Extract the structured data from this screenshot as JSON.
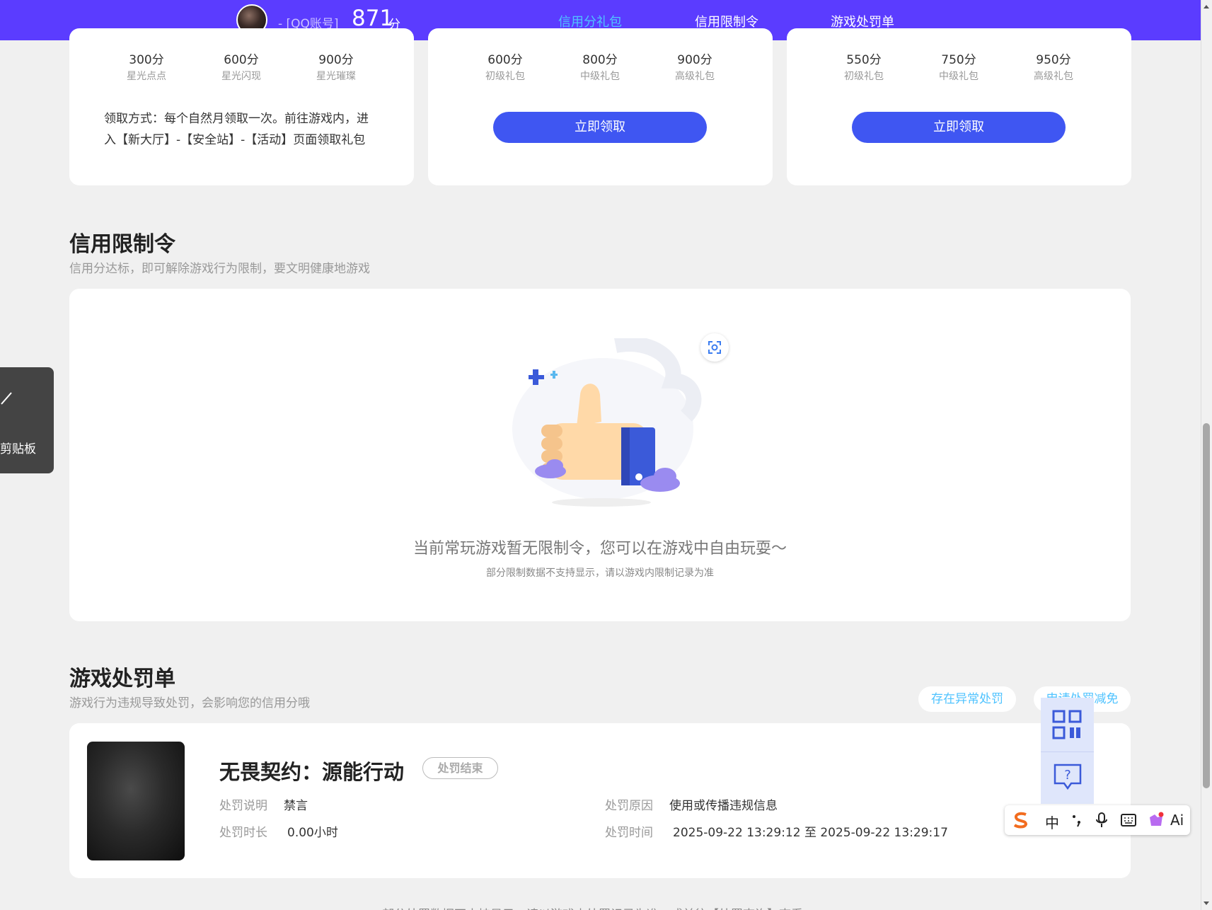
{
  "header": {
    "account_label": "- [QQ账号]",
    "score": "871",
    "score_unit": "分",
    "tabs": [
      {
        "label": "信用分礼包",
        "active": true
      },
      {
        "label": "信用限制令",
        "active": false
      },
      {
        "label": "游戏处罚单",
        "active": false
      }
    ],
    "brand_color": "#5b3cff",
    "accent_color": "#4fc3ff"
  },
  "gift_cards": [
    {
      "tiers": [
        {
          "value": "300分",
          "name": "星光点点"
        },
        {
          "value": "600分",
          "name": "星光闪现"
        },
        {
          "value": "900分",
          "name": "星光璀璨"
        }
      ],
      "note_line1": "领取方式：每个自然月领取一次。前往游戏内，进",
      "note_line2": "入【新大厅】-【安全站】-【活动】页面领取礼包"
    },
    {
      "tiers": [
        {
          "value": "600分",
          "name": "初级礼包"
        },
        {
          "value": "800分",
          "name": "中级礼包"
        },
        {
          "value": "900分",
          "name": "高级礼包"
        }
      ],
      "button": "立即领取"
    },
    {
      "tiers": [
        {
          "value": "550分",
          "name": "初级礼包"
        },
        {
          "value": "750分",
          "name": "中级礼包"
        },
        {
          "value": "950分",
          "name": "高级礼包"
        }
      ],
      "button": "立即领取"
    }
  ],
  "restriction": {
    "title": "信用限制令",
    "subtitle": "信用分达标，即可解除游戏行为限制，要文明健康地游戏",
    "empty_text": "当前常玩游戏暂无限制令，您可以在游戏中自由玩耍～",
    "empty_sub": "部分限制数据不支持显示，请以游戏内限制记录为准"
  },
  "penalty": {
    "title": "游戏处罚单",
    "subtitle": "游戏行为违规导致处罚，会影响您的信用分哦",
    "btn_abnormal": "存在异常处罚",
    "btn_appeal": "申请处罚减免",
    "game_name": "无畏契约：源能行动",
    "status": "处罚结束",
    "desc_label": "处罚说明",
    "desc_value": "禁言",
    "duration_label": "处罚时长",
    "duration_value": "0.00小时",
    "reason_label": "处罚原因",
    "reason_value": "使用或传播违规信息",
    "time_label": "处罚时间",
    "time_value": "2025-09-22 13:29:12 至 2025-09-22 13:29:17"
  },
  "clipboard": {
    "label": "剪贴板"
  },
  "ime": {
    "lang": "中",
    "ai": "Ai"
  },
  "footer_partial": "部分处罚数据不支持显示，请以游戏内处罚记录为准，或前往【处罚查询】查看"
}
